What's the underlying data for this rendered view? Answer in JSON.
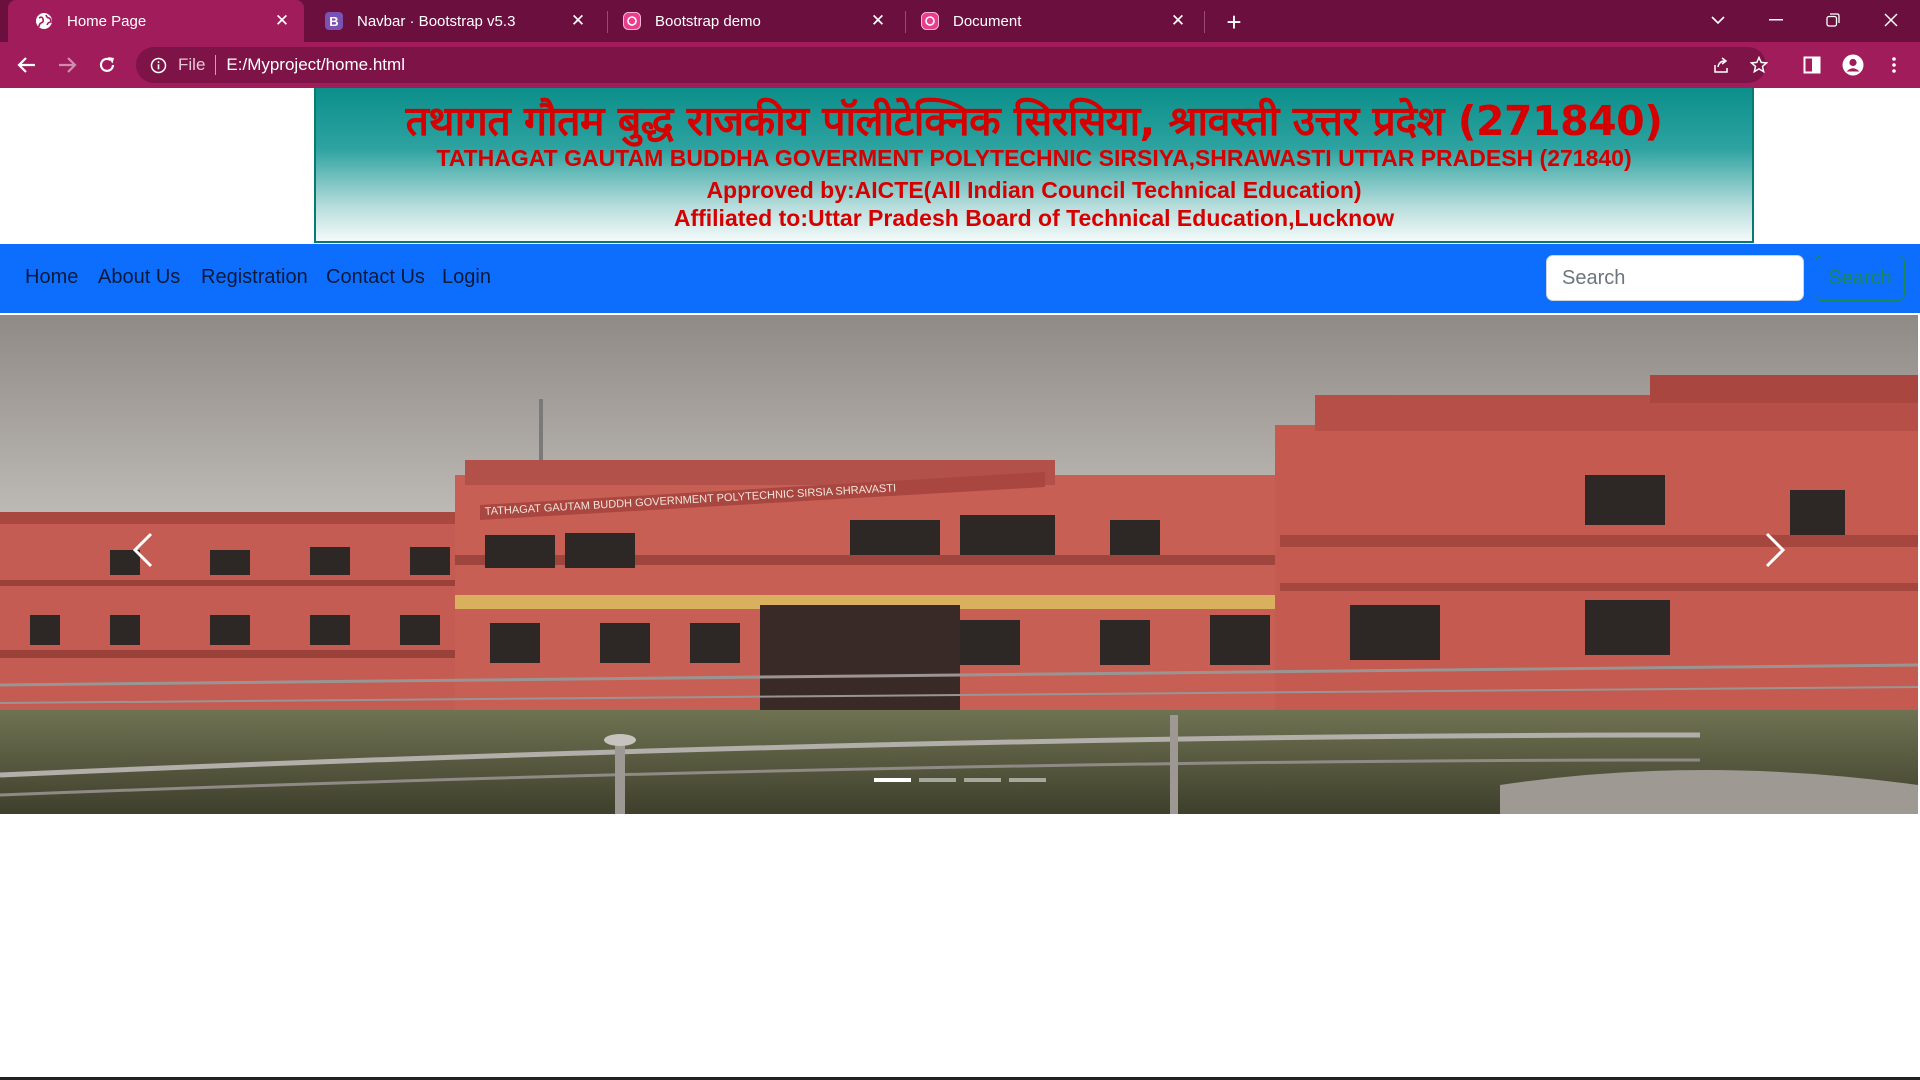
{
  "browser": {
    "tabs": [
      {
        "title": "Home Page",
        "active": true,
        "favicon": "globe-icon"
      },
      {
        "title": "Navbar · Bootstrap v5.3",
        "active": false,
        "favicon": "bootstrap-icon"
      },
      {
        "title": "Bootstrap demo",
        "active": false,
        "favicon": "webpage-icon"
      },
      {
        "title": "Document",
        "active": false,
        "favicon": "webpage-icon"
      }
    ],
    "address": {
      "scheme_label": "File",
      "url": "E:/Myproject/home.html"
    },
    "colors": {
      "tabstrip": "#6b0f3f",
      "toolbar": "#a01c5b",
      "omnibox": "#7e1347"
    }
  },
  "banner": {
    "hindi_title": "तथागत गौतम बुद्ध राजकीय पॉलीटेक्निक सिरसिया, श्रावस्ती उत्तर प्रदेश (271840)",
    "english_title": "TATHAGAT GAUTAM BUDDHA GOVERMENT POLYTECHNIC SIRSIYA,SHRAWASTI UTTAR PRADESH (271840)",
    "approved": "Approved by:AICTE(All Indian Council Technical Education)",
    "affiliated": "Affiliated to:Uttar Pradesh Board of Technical Education,Lucknow",
    "text_color": "#d50000"
  },
  "navbar": {
    "links": [
      "Home",
      "About Us",
      "Registration",
      "Contact Us",
      "Login"
    ],
    "search": {
      "placeholder": "Search",
      "button_label": "Search"
    },
    "background": "#0d6efd"
  },
  "carousel": {
    "image_signboard": "TATHAGAT GAUTAM BUDDH GOVERNMENT POLYTECHNIC SIRSIA SHRAVASTI",
    "slide_count": 4,
    "active_index": 0
  }
}
